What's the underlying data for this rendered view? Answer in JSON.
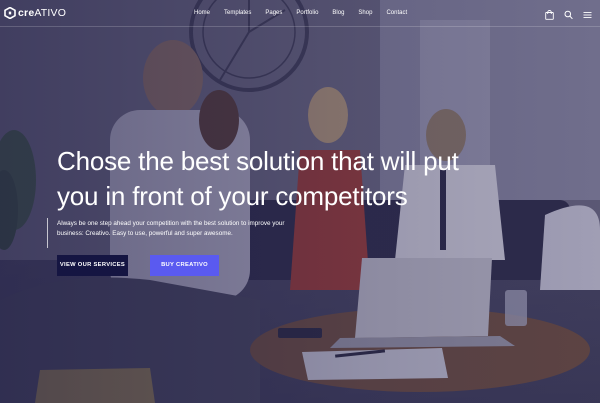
{
  "brand": {
    "logo_text_bold": "cre",
    "logo_text_rest": "ATIVO"
  },
  "nav": {
    "items": [
      "Home",
      "Templates",
      "Pages",
      "Portfolio",
      "Blog",
      "Shop",
      "Contact"
    ],
    "icons": [
      "shopping-bag-icon",
      "search-icon",
      "menu-icon"
    ]
  },
  "hero": {
    "headline_line1": "Chose the best solution that will put",
    "headline_line2": "you in front of your competitors",
    "subline_line1": "Always be one step ahead your competition with the best solution to improve your",
    "subline_line2": "business: Creativo. Easy to use, powerful and super awesome.",
    "button_secondary": "VIEW OUR SERVICES",
    "button_primary": "BUY CREATIVO"
  },
  "colors": {
    "overlay": "#2a2850",
    "button_dark": "#151542",
    "button_primary": "#5a5af0",
    "text": "#ffffff"
  }
}
